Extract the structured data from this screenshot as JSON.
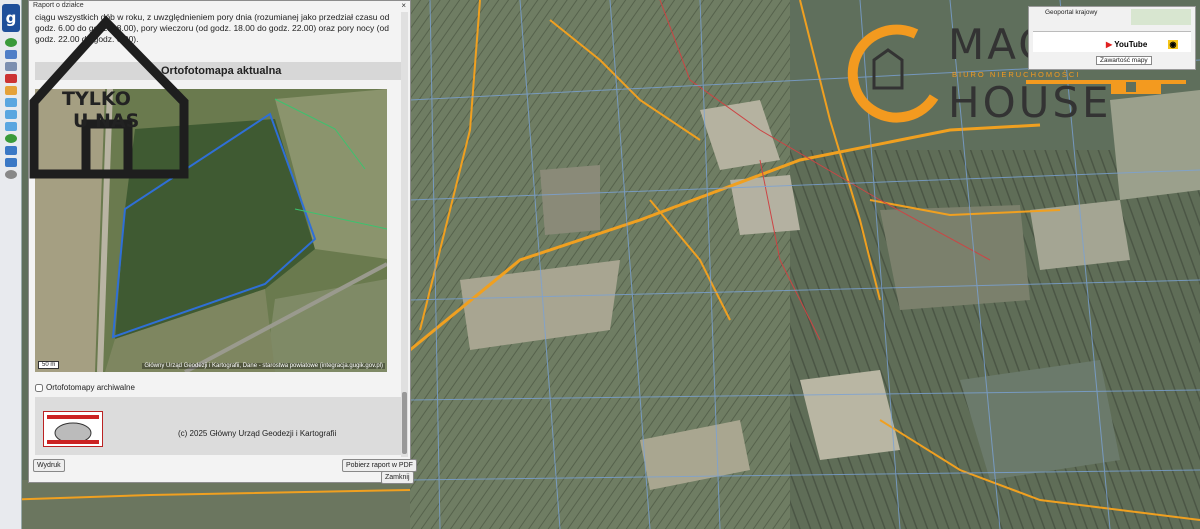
{
  "report_window": {
    "title": "Raport o działce",
    "close_glyph": "×",
    "intro_text": "ciągu wszystkich dób w roku, z uwzględnieniem pory dnia (rozumianej jako przedział czasu od godz. 6.00 do godz. 18.00), pory wieczoru (od godz. 18.00 do godz. 22.00) oraz pory nocy (od godz. 22.00 do godz. 6.00).",
    "section_heading": "Ortofotomapa aktualna",
    "scale_label": "50 m",
    "map_credit": "Główny Urząd Geodezji i Kartografii, Dane - starostwa powiatowe (integracja.gugik.gov.pl)",
    "archive_checkbox_label": "Ortofotomapy archiwalne",
    "copyright": "(c) 2025 Główny Urząd Geodezji i Kartografii",
    "print_button": "Wydruk",
    "download_button": "Pobierz raport w PDF",
    "close_button": "Zamknij"
  },
  "watermark": {
    "line1": "TYLKO",
    "line2": "U NAS"
  },
  "brand_logo": {
    "line1": "MAGIC",
    "line2": "HOUSE",
    "tagline": "BIURO NIERUCHOMOŚCI"
  },
  "geoportal_panel": {
    "label": "Geoportal krajowy",
    "youtube": "YouTube",
    "map_contents_button": "Zawartość mapy"
  },
  "icons": [
    "geoportal-logo-icon",
    "info-icon",
    "layers-icon",
    "zoom-in-icon",
    "zoom-out-icon",
    "arrow-left-icon",
    "arrow-right-icon",
    "settings-icon",
    "house-icon",
    "key-icon",
    "youtube-icon",
    "eye-icon"
  ],
  "colors": {
    "accent_orange": "#f39a1f",
    "logo_dark": "#333333",
    "geoportal_blue": "#1f4f9a"
  }
}
